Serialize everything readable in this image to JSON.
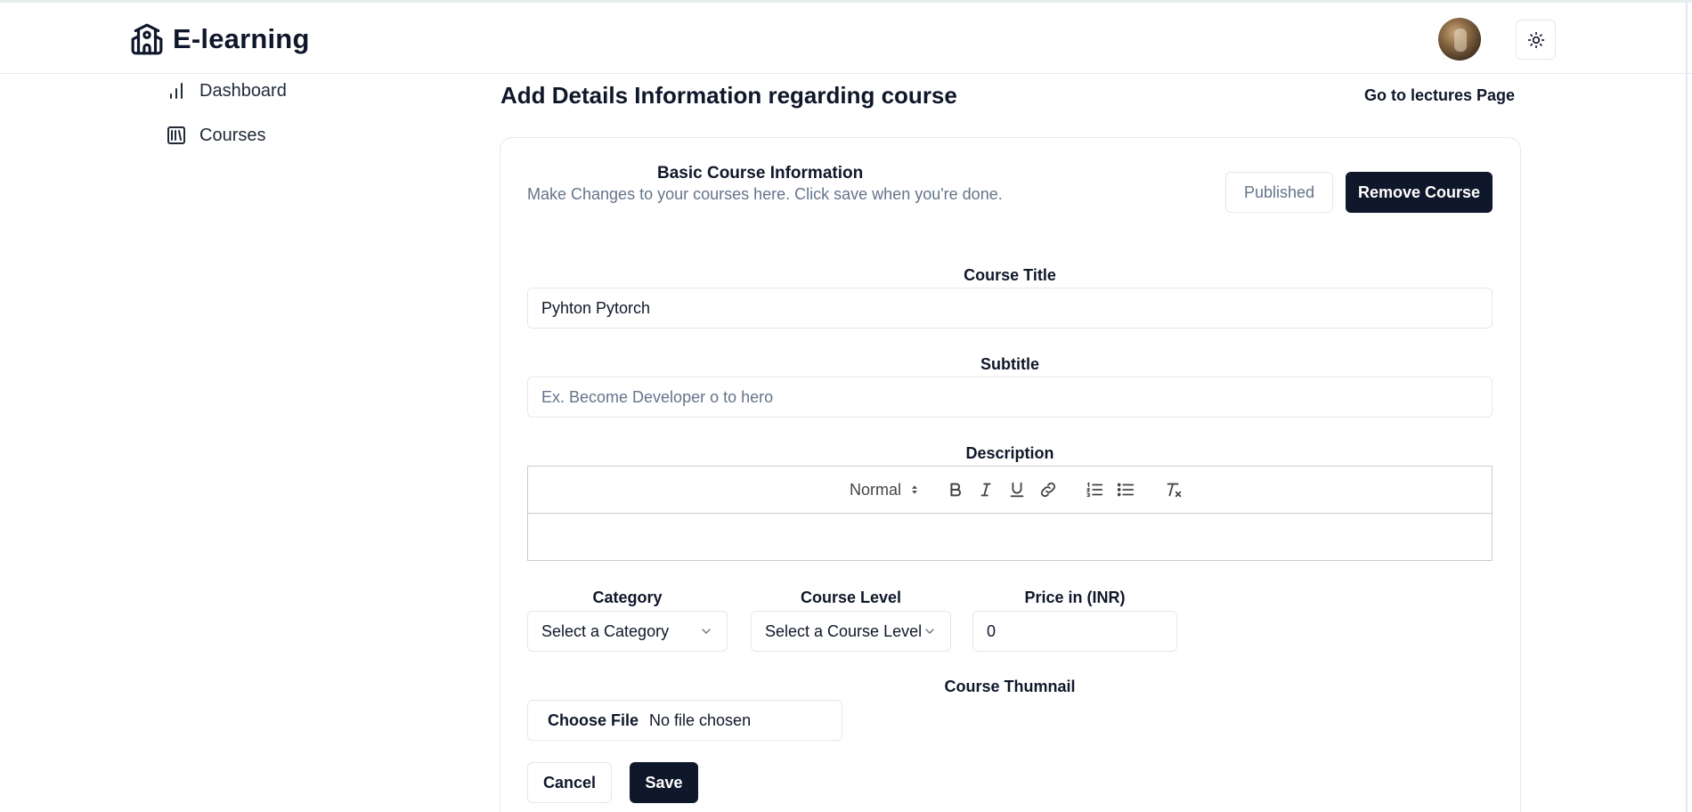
{
  "navbar": {
    "brand": "E-learning",
    "brand_icon": "school-icon",
    "theme_icon": "sun-icon"
  },
  "sidebar": {
    "items": [
      {
        "label": "Dashboard",
        "icon": "bar-chart-icon"
      },
      {
        "label": "Courses",
        "icon": "library-icon"
      }
    ]
  },
  "page": {
    "title": "Add Details Information regarding course",
    "go_lectures": "Go to lectures Page"
  },
  "card": {
    "title": "Basic Course Information",
    "description": "Make Changes to your courses here. Click save when you're done.",
    "published_label": "Published",
    "remove_label": "Remove Course"
  },
  "form": {
    "course_title_label": "Course Title",
    "course_title_value": "Pyhton Pytorch",
    "subtitle_label": "Subtitle",
    "subtitle_placeholder": "Ex. Become Developer o to hero",
    "description_label": "Description",
    "editor": {
      "header_select": "Normal"
    },
    "category_label": "Category",
    "category_value": "Select a Category",
    "level_label": "Course Level",
    "level_value": "Select a Course Level",
    "price_label": "Price in (INR)",
    "price_value": "0",
    "thumbnail_label": "Course Thumnail",
    "file_button": "Choose File",
    "file_status": "No file chosen",
    "cancel_label": "Cancel",
    "save_label": "Save"
  },
  "colors": {
    "primary": "#0f172a",
    "muted": "#64748b",
    "border": "#e2e8f0"
  }
}
